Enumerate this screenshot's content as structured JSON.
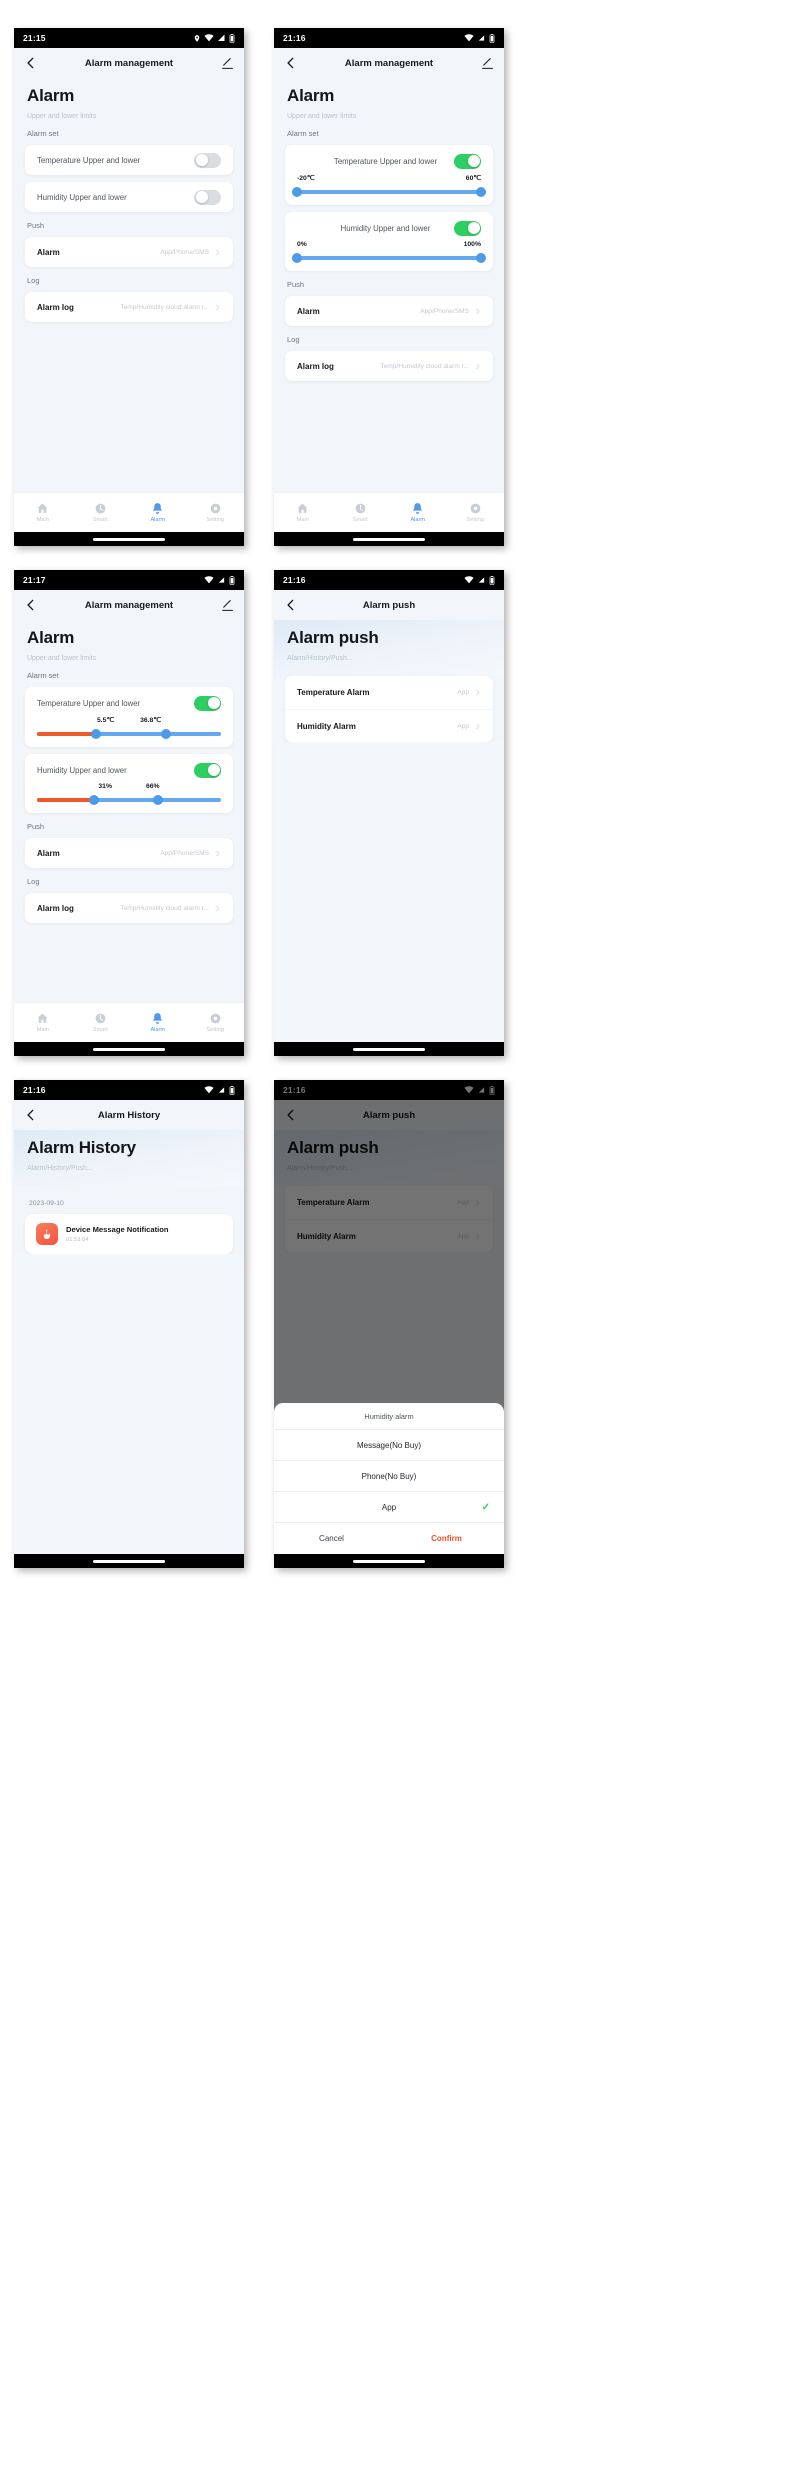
{
  "screens": [
    {
      "id": "alarm-management-off",
      "status": {
        "time": "21:15",
        "icons": [
          "location-icon",
          "wifi-icon",
          "signal-icon",
          "battery-icon"
        ]
      },
      "nav": {
        "title": "Alarm management",
        "back": "back-icon",
        "action": "edit-icon"
      },
      "header": {
        "title": "Alarm",
        "subtitle": "Upper and lower limits"
      },
      "sections": {
        "alarm_set": "Alarm set",
        "push": "Push",
        "log": "Log"
      },
      "toggles": [
        {
          "label": "Temperature Upper and lower",
          "on": false
        },
        {
          "label": "Humidity Upper and lower",
          "on": false
        }
      ],
      "push_row": {
        "label": "Alarm",
        "value": "App/Phone/SMS"
      },
      "log_row": {
        "label": "Alarm log",
        "value": "Temp/Humidity cloud alarm r..."
      },
      "tabs": [
        {
          "label": "Main",
          "icon": "home-icon",
          "active": false
        },
        {
          "label": "Smart",
          "icon": "clock-icon",
          "active": false
        },
        {
          "label": "Alarm",
          "icon": "bell-icon",
          "active": true
        },
        {
          "label": "Setting",
          "icon": "gear-icon",
          "active": false
        }
      ]
    },
    {
      "id": "alarm-management-on-default",
      "status": {
        "time": "21:16",
        "icons": [
          "wifi-icon",
          "signal-icon",
          "battery-icon"
        ]
      },
      "nav": {
        "title": "Alarm management",
        "back": "back-icon",
        "action": "edit-icon"
      },
      "header": {
        "title": "Alarm",
        "subtitle": "Upper and lower limits"
      },
      "sections": {
        "alarm_set": "Alarm set",
        "push": "Push",
        "log": "Log"
      },
      "sliders": [
        {
          "label": "Temperature Upper and lower",
          "on": true,
          "min_value": "-20℃",
          "max_value": "60℃",
          "low_pct": 0,
          "high_pct": 100
        },
        {
          "label": "Humidity Upper and lower",
          "on": true,
          "min_value": "0%",
          "max_value": "100%",
          "low_pct": 0,
          "high_pct": 100
        }
      ],
      "push_row": {
        "label": "Alarm",
        "value": "App/Phone/SMS"
      },
      "log_row": {
        "label": "Alarm log",
        "value": "Temp/Humidity cloud alarm r..."
      },
      "tabs": [
        {
          "label": "Main",
          "icon": "home-icon",
          "active": false
        },
        {
          "label": "Smart",
          "icon": "clock-icon",
          "active": false
        },
        {
          "label": "Alarm",
          "icon": "bell-icon",
          "active": true
        },
        {
          "label": "Setting",
          "icon": "gear-icon",
          "active": false
        }
      ]
    },
    {
      "id": "alarm-management-on-adjusted",
      "status": {
        "time": "21:17",
        "icons": [
          "wifi-icon",
          "signal-icon",
          "battery-icon"
        ]
      },
      "nav": {
        "title": "Alarm management",
        "back": "back-icon",
        "action": "edit-icon"
      },
      "header": {
        "title": "Alarm",
        "subtitle": "Upper and lower limits"
      },
      "sections": {
        "alarm_set": "Alarm set",
        "push": "Push",
        "log": "Log"
      },
      "sliders": [
        {
          "label": "Temperature Upper and lower",
          "on": true,
          "min_value": "5.5℃",
          "max_value": "36.8℃",
          "low_pct": 32,
          "high_pct": 70
        },
        {
          "label": "Humidity Upper and lower",
          "on": true,
          "min_value": "31%",
          "max_value": "66%",
          "low_pct": 31,
          "high_pct": 66
        }
      ],
      "push_row": {
        "label": "Alarm",
        "value": "App/Phone/SMS"
      },
      "log_row": {
        "label": "Alarm log",
        "value": "Temp/Humidity cloud alarm r..."
      },
      "tabs": [
        {
          "label": "Main",
          "icon": "home-icon",
          "active": false
        },
        {
          "label": "Smart",
          "icon": "clock-icon",
          "active": false
        },
        {
          "label": "Alarm",
          "icon": "bell-icon",
          "active": true
        },
        {
          "label": "Setting",
          "icon": "gear-icon",
          "active": false
        }
      ]
    },
    {
      "id": "alarm-push",
      "status": {
        "time": "21:16",
        "icons": [
          "wifi-icon",
          "signal-icon",
          "battery-icon"
        ]
      },
      "nav": {
        "title": "Alarm push",
        "back": "back-icon"
      },
      "header": {
        "title": "Alarm push",
        "subtitle": "Alarm/History/Push..."
      },
      "rows": [
        {
          "label": "Temperature Alarm",
          "value": "App"
        },
        {
          "label": "Humidity Alarm",
          "value": "App"
        }
      ]
    },
    {
      "id": "alarm-history",
      "status": {
        "time": "21:16",
        "icons": [
          "wifi-icon",
          "signal-icon",
          "battery-icon"
        ]
      },
      "nav": {
        "title": "Alarm History",
        "back": "back-icon"
      },
      "header": {
        "title": "Alarm History",
        "subtitle": "Alarm/History/Push..."
      },
      "date": "2023-09-10",
      "entry": {
        "icon": "fire-alert-icon",
        "title": "Device Message Notification",
        "time": "01:53:04"
      }
    },
    {
      "id": "alarm-push-sheet",
      "status": {
        "time": "21:16",
        "icons": [
          "wifi-icon",
          "signal-icon",
          "battery-icon"
        ]
      },
      "nav": {
        "title": "Alarm push",
        "back": "back-icon"
      },
      "header": {
        "title": "Alarm push",
        "subtitle": "Alarm/History/Push..."
      },
      "rows": [
        {
          "label": "Temperature Alarm",
          "value": "App"
        },
        {
          "label": "Humidity Alarm",
          "value": "App"
        }
      ],
      "sheet": {
        "title": "Humidity alarm",
        "options": [
          {
            "label": "Message(No Buy)",
            "selected": false
          },
          {
            "label": "Phone(No Buy)",
            "selected": false
          },
          {
            "label": "App",
            "selected": true
          }
        ],
        "cancel": "Cancel",
        "confirm": "Confirm",
        "check_glyph": "✓"
      }
    }
  ],
  "colors": {
    "accent_blue": "#4d9aea",
    "toggle_on_green": "#2fce63",
    "slider_red": "#ef5a2a",
    "confirm_orange": "#ef4d26"
  }
}
